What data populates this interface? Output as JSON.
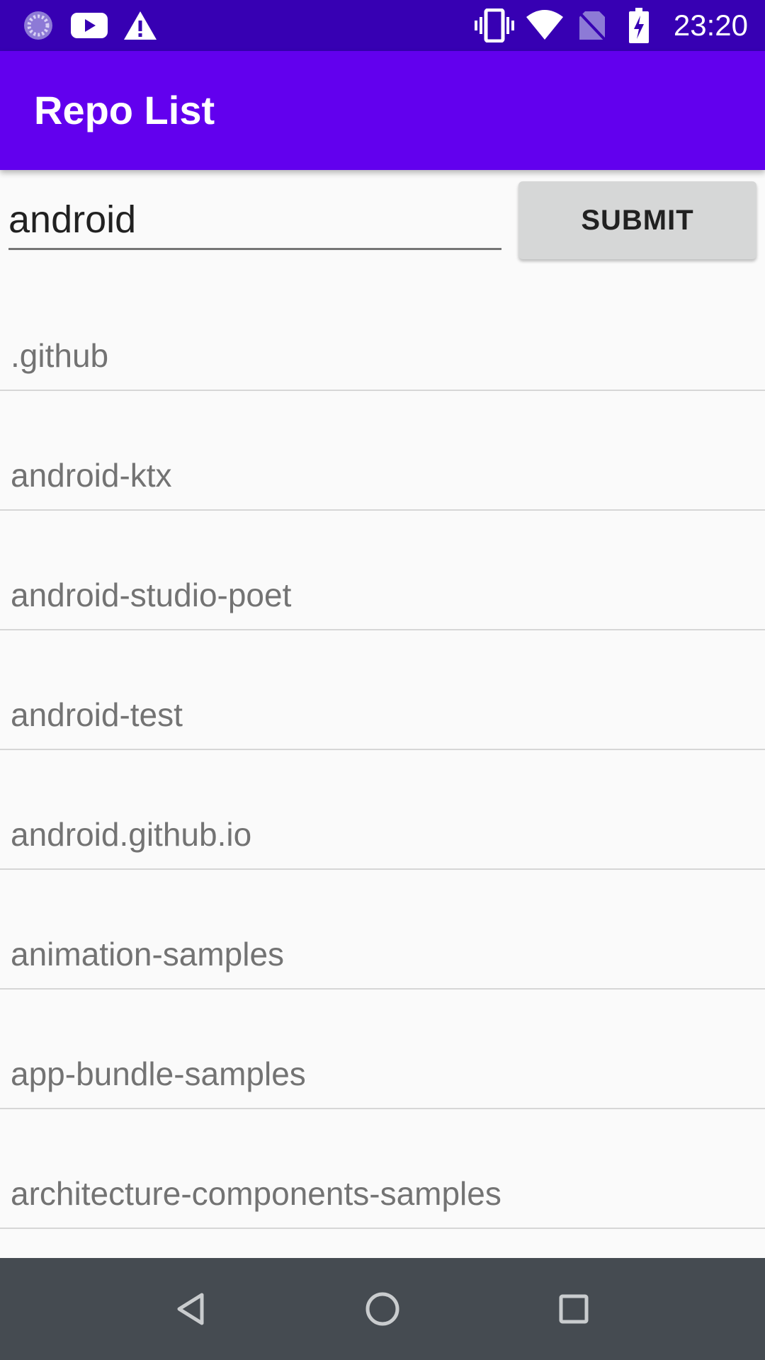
{
  "status_bar": {
    "time": "23:20",
    "icons": [
      "loading-icon",
      "youtube-icon",
      "warning-icon",
      "vibrate-icon",
      "wifi-icon",
      "no-sim-icon",
      "battery-charging-icon"
    ]
  },
  "app_bar": {
    "title": "Repo List"
  },
  "search": {
    "value": "android",
    "submit_label": "SUBMIT"
  },
  "repos": [
    ".github",
    "android-ktx",
    "android-studio-poet",
    "android-test",
    "android.github.io",
    "animation-samples",
    "app-bundle-samples",
    "architecture-components-samples"
  ],
  "nav_bar": {
    "icons": [
      "back-icon",
      "home-icon",
      "recents-icon"
    ]
  },
  "colors": {
    "status_bar": "#3700b3",
    "app_bar": "#6200ee",
    "background": "#fafafa",
    "button": "#d6d7d7",
    "nav_bar": "#454b51",
    "list_text": "#737373"
  }
}
